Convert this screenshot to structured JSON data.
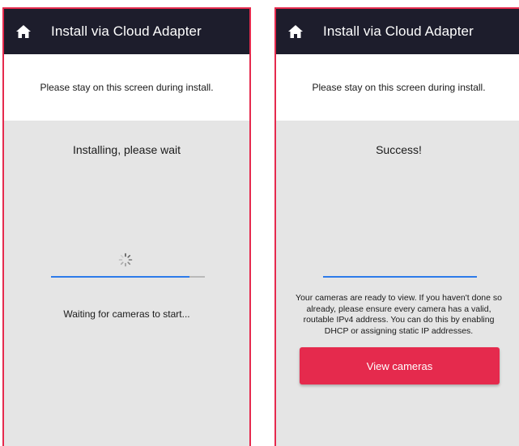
{
  "colors": {
    "header_bg": "#1d1d2c",
    "frame_border": "#e52a4d",
    "accent_button": "#e52a4d",
    "progress_fill": "#2d7bea",
    "progress_track": "#b9b9b9",
    "content_bg": "#e5e5e5"
  },
  "screens": [
    {
      "header": {
        "title": "Install via Cloud Adapter",
        "icon": "home-icon"
      },
      "notice": "Please stay on this screen during install.",
      "status_title": "Installing, please wait",
      "spinner_icon": "spinner-icon",
      "progress_percent": 90,
      "waiting_text": "Waiting for cameras to start..."
    },
    {
      "header": {
        "title": "Install via Cloud Adapter",
        "icon": "home-icon"
      },
      "notice": "Please stay on this screen during install.",
      "status_title": "Success!",
      "progress_percent": 100,
      "ready_text": "Your cameras are ready to view. If you haven't done so already, please ensure every camera has a valid, routable IPv4 address. You can do this by enabling DHCP or assigning static IP addresses.",
      "button_label": "View cameras"
    }
  ]
}
